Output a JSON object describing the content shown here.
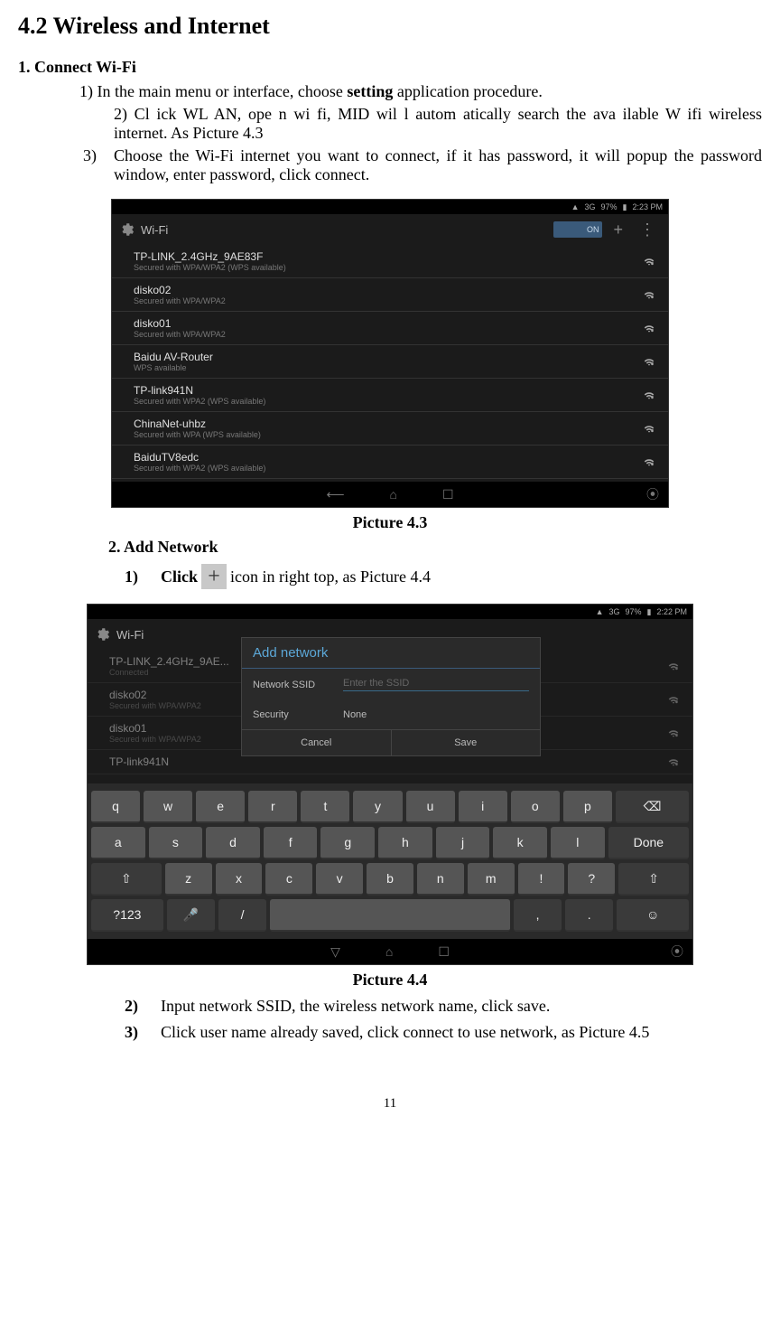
{
  "heading": "4.2 Wireless and Internet",
  "sub1": "1. Connect Wi-Fi",
  "item1_pre": "1) In the main menu or interface, choose ",
  "item1_bold": "setting",
  "item1_post": " application procedure.",
  "item2": "2) Cl ick WL AN, ope n wi fi, MID wil  l autom atically search   the ava ilable W ifi wireless internet. As Picture 4.3",
  "item3_num": "3)",
  "item3": "Choose the Wi-Fi internet you want to  connect, if it has  password, it will popup the password window, enter password, click connect.",
  "caption1": "Picture 4.3",
  "section2": "2.    Add Network",
  "s2_1_num": "1)",
  "s2_1_pre": "Click",
  "s2_1_post": "  icon in right top, as Picture 4.4",
  "caption2": "Picture 4.4",
  "s2_2_num": "2)",
  "s2_2": "Input network SSID, the wireless network name, click save.",
  "s2_3_num": "3)",
  "s2_3": "Click user name already saved, click connect to use network, as Picture 4.5",
  "pagenum": "11",
  "screenshot1": {
    "status": {
      "signal": "3G",
      "battery": "97%",
      "time": "2:23 PM"
    },
    "title": "Wi-Fi",
    "toggle": "ON",
    "networks": [
      {
        "name": "TP-LINK_2.4GHz_9AE83F",
        "sub": "Secured with WPA/WPA2 (WPS available)"
      },
      {
        "name": "disko02",
        "sub": "Secured with WPA/WPA2"
      },
      {
        "name": "disko01",
        "sub": "Secured with WPA/WPA2"
      },
      {
        "name": "Baidu AV-Router",
        "sub": "WPS available"
      },
      {
        "name": "TP-link941N",
        "sub": "Secured with WPA2 (WPS available)"
      },
      {
        "name": "ChinaNet-uhbz",
        "sub": "Secured with WPA (WPS available)"
      },
      {
        "name": "BaiduTV8edc",
        "sub": "Secured with WPA2 (WPS available)"
      }
    ]
  },
  "screenshot2": {
    "status": {
      "signal": "3G",
      "battery": "97%",
      "time": "2:22 PM"
    },
    "title": "Wi-Fi",
    "networks": [
      {
        "name": "TP-LINK_2.4GHz_9AE...",
        "sub": "Connected"
      },
      {
        "name": "disko02",
        "sub": "Secured with WPA/WPA2"
      },
      {
        "name": "disko01",
        "sub": "Secured with WPA/WPA2"
      },
      {
        "name": "TP-link941N",
        "sub": ""
      }
    ],
    "dialog": {
      "title": "Add network",
      "ssid_label": "Network SSID",
      "ssid_placeholder": "Enter the SSID",
      "sec_label": "Security",
      "sec_value": "None",
      "cancel": "Cancel",
      "save": "Save"
    },
    "keys_r1": [
      "q",
      "w",
      "e",
      "r",
      "t",
      "y",
      "u",
      "i",
      "o",
      "p"
    ],
    "keys_r2": [
      "a",
      "s",
      "d",
      "f",
      "g",
      "h",
      "j",
      "k",
      "l"
    ],
    "keys_r3": [
      "z",
      "x",
      "c",
      "v",
      "b",
      "n",
      "m",
      "!",
      "?"
    ],
    "done": "Done",
    "sym": "?123"
  }
}
